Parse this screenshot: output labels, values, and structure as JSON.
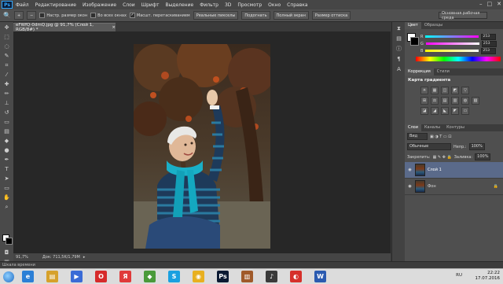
{
  "menubar": {
    "logo": "Ps",
    "items": [
      "Файл",
      "Редактирование",
      "Изображение",
      "Слои",
      "Шрифт",
      "Выделение",
      "Фильтр",
      "3D",
      "Просмотр",
      "Окно",
      "Справка"
    ]
  },
  "options": {
    "resize_windows": "Настр. размер окон",
    "all_windows": "Во всех окнах",
    "scrubby_zoom": "Масшт. перетаскиванием",
    "actual_pixels": "Реальные пикселы",
    "fit_screen": "Подогнать",
    "full_screen": "Полный экран",
    "print_size": "Размер оттиска",
    "workspace": "Основная рабочая среда"
  },
  "document": {
    "tab_title": "eFWfQ-0dmQ.jpg @ 91,7% (Слой 1, RGB/8#) *",
    "zoom": "91,7%",
    "doc_size": "Док: 711,5K/1,79M"
  },
  "timeline": {
    "label": "Шкала времени"
  },
  "color_panel": {
    "tabs": [
      "Цвет",
      "Образцы"
    ],
    "channels": [
      {
        "label": "R",
        "value": "253",
        "color": "#e04a4a"
      },
      {
        "label": "G",
        "value": "253",
        "color": "#4ac84a"
      },
      {
        "label": "B",
        "value": "253",
        "color": "#4a7ae0"
      }
    ]
  },
  "adjustments_panel": {
    "tabs": [
      "Коррекция",
      "Стили"
    ],
    "title": "Карта градиента",
    "row1": [
      "☀",
      "▦",
      "◫",
      "◩",
      "▽"
    ],
    "row2": [
      "⊞",
      "⚖",
      "▤",
      "▥",
      "◍",
      "▧"
    ],
    "row3": [
      "◪",
      "◢",
      "◣",
      "◤",
      "▭"
    ]
  },
  "layers_panel": {
    "tabs": [
      "Слои",
      "Каналы",
      "Контуры"
    ],
    "kind": "Вид",
    "blend_mode": "Обычные",
    "opacity_label": "Непр.:",
    "opacity": "100%",
    "lock_label": "Закрепить:",
    "fill_label": "Заливка:",
    "fill": "100%",
    "layers": [
      {
        "name": "Слой 1",
        "active": true
      },
      {
        "name": "Фон",
        "active": false
      }
    ]
  },
  "taskbar": {
    "lang": "RU",
    "time": "22:22",
    "date": "17.07.2016",
    "apps": [
      {
        "glyph": "e",
        "color": "#2b7fd6"
      },
      {
        "glyph": "▤",
        "color": "#d6a12b"
      },
      {
        "glyph": "▶",
        "color": "#3a6bd6"
      },
      {
        "glyph": "O",
        "color": "#d62b2b"
      },
      {
        "glyph": "Я",
        "color": "#e03a3a"
      },
      {
        "glyph": "◆",
        "color": "#4a9a3a"
      },
      {
        "glyph": "S",
        "color": "#1aa0e0"
      },
      {
        "glyph": "◉",
        "color": "#e8b020"
      },
      {
        "glyph": "Ps",
        "color": "#0b1a33"
      },
      {
        "glyph": "▥",
        "color": "#a05a2a"
      },
      {
        "glyph": "♪",
        "color": "#3a3a3a"
      },
      {
        "glyph": "◐",
        "color": "#d6302b"
      },
      {
        "glyph": "W",
        "color": "#2b5bb0"
      }
    ]
  }
}
